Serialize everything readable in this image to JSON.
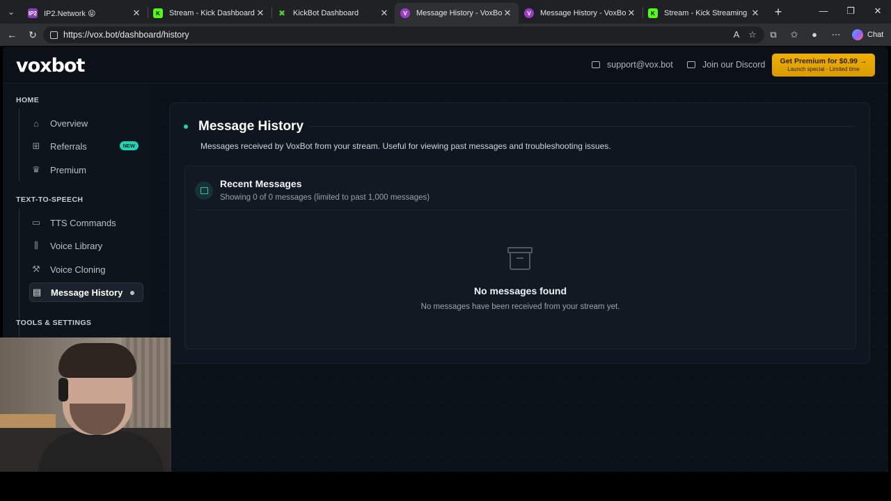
{
  "browser": {
    "tabs": [
      {
        "title": "IP2.Network 😝",
        "favicon": "IP2",
        "favicon_color": "#8a3fb8"
      },
      {
        "title": "Stream - Kick Dashboard",
        "favicon": "K",
        "favicon_color": "#53fc18"
      },
      {
        "title": "KickBot Dashboard",
        "favicon": "✖",
        "favicon_color": "#4bd12d"
      },
      {
        "title": "Message History - VoxBot",
        "favicon": "V",
        "favicon_color": "#9b3cc8",
        "active": true
      },
      {
        "title": "Message History - VoxBot",
        "favicon": "V",
        "favicon_color": "#9b3cc8"
      },
      {
        "title": "Stream - Kick Streaming",
        "favicon": "K",
        "favicon_color": "#53fc18"
      }
    ],
    "url": "https://vox.bot/dashboard/history",
    "chat_label": "Chat"
  },
  "topnav": {
    "brand": "voxbot",
    "support_email": "support@vox.bot",
    "discord_label": "Join our Discord",
    "premium_title": "Get Premium for $0.99 →",
    "premium_sub": "Launch special · Limited time"
  },
  "sidebar": {
    "sections": [
      {
        "title": "HOME",
        "items": [
          {
            "label": "Overview",
            "icon": "home-icon"
          },
          {
            "label": "Referrals",
            "icon": "gift-icon",
            "badge": "NEW"
          },
          {
            "label": "Premium",
            "icon": "crown-icon"
          }
        ]
      },
      {
        "title": "TEXT-TO-SPEECH",
        "items": [
          {
            "label": "TTS Commands",
            "icon": "chat-icon"
          },
          {
            "label": "Voice Library",
            "icon": "library-icon"
          },
          {
            "label": "Voice Cloning",
            "icon": "hammer-icon"
          },
          {
            "label": "Message History",
            "icon": "archive-icon",
            "active": true
          }
        ]
      },
      {
        "title": "TOOLS & SETTINGS",
        "items": []
      }
    ]
  },
  "main": {
    "title": "Message History",
    "description": "Messages received by VoxBot from your stream. Useful for viewing past messages and troubleshooting issues.",
    "recent": {
      "title": "Recent Messages",
      "subtitle": "Showing 0 of 0 messages (limited to past 1,000 messages)",
      "empty_title": "No messages found",
      "empty_sub": "No messages have been received from your stream yet."
    }
  },
  "colors": {
    "accent": "#22d3a6",
    "premium": "#f0b000",
    "background": "#0b1119"
  }
}
